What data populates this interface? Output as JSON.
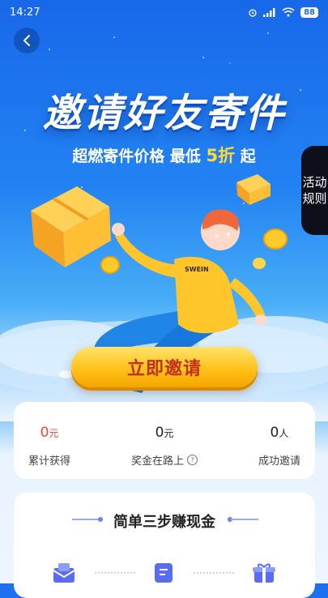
{
  "status_bar": {
    "time": "14:27",
    "battery": "88"
  },
  "hero": {
    "title": "邀请好友寄件",
    "subtitle_prefix": "超燃寄件价格 最低 ",
    "subtitle_highlight": "5折",
    "subtitle_suffix": " 起"
  },
  "rules_tab": {
    "line1": "活动",
    "line2": "规则"
  },
  "invite_button": {
    "label": "立即邀请"
  },
  "stats": [
    {
      "value": "0",
      "unit": "元",
      "label": "累计获得"
    },
    {
      "value": "0",
      "unit": "元",
      "label": "奖金在路上"
    },
    {
      "value": "0",
      "unit": "人",
      "label": "成功邀请"
    }
  ],
  "steps": {
    "title": "简单三步赚现金"
  },
  "colors": {
    "accent_yellow": "#ffd83a",
    "stat_red": "#e04a3a",
    "button_text": "#c0301b"
  }
}
